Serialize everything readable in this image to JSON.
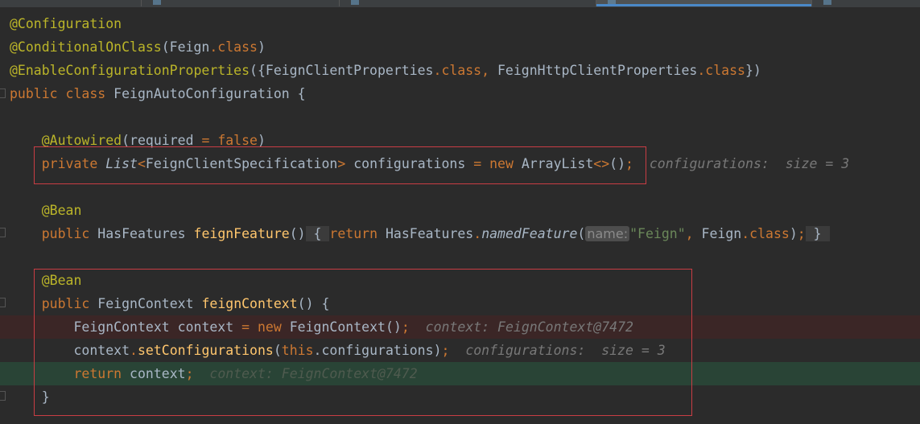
{
  "tabs": [
    {
      "label": "",
      "active": false
    },
    {
      "label": "",
      "active": false
    },
    {
      "label": "",
      "active": false
    },
    {
      "label": "",
      "active": true
    },
    {
      "label": "",
      "active": false
    }
  ],
  "colors": {
    "background": "#2b2b2b",
    "keyword": "#cc7832",
    "annotation": "#bbb529",
    "string": "#6a8759",
    "text": "#a9b7c6",
    "hint": "#787878",
    "highlight_red": "#3b2626",
    "highlight_green": "#294436",
    "box_red": "#c93d44"
  },
  "code": {
    "l1": {
      "ann": "@Configuration"
    },
    "l2": {
      "ann": "@ConditionalOnClass",
      "args": "(Feign",
      "dot": ".",
      "cls": "class",
      "close": ")"
    },
    "l3": {
      "ann": "@EnableConfigurationProperties",
      "open": "({FeignClientProperties",
      "dot1": ".",
      "cls1": "class",
      "comma": ", ",
      "second": "FeignHttpClientProperties",
      "dot2": ".",
      "cls2": "class",
      "close": "})"
    },
    "l4": {
      "kw1": "public",
      "kw2": "class",
      "name": "FeignAutoConfiguration",
      "brace": "{"
    },
    "l6": {
      "ann": "@Autowired",
      "open": "(required ",
      "eq": "=",
      "val": "false",
      "close": ")"
    },
    "l7": {
      "kw": "private",
      "type": "List",
      "lt": "<",
      "generic": "FeignClientSpecification",
      "gt": ">",
      "name": "configurations",
      "eq": "=",
      "new": "new",
      "ctor": "ArrayList",
      "diamond": "<>",
      "parens": "()",
      "semi": ";",
      "hint": "configurations:  size = 3"
    },
    "l9": {
      "ann": "@Bean"
    },
    "l10": {
      "kw": "public",
      "type": "HasFeatures",
      "name": "feignFeature",
      "parens": "()",
      "obrace": "{",
      "ret": "return",
      "cls": "HasFeatures",
      "dot": ".",
      "method": "namedFeature",
      "open": "(",
      "param_hint": "name:",
      "str": "\"Feign\"",
      "comma": ", ",
      "arg2": "Feign",
      "dot2": ".",
      "cls2": "class",
      "close": ")",
      "semi": ";",
      "cbrace": "}"
    },
    "l12": {
      "ann": "@Bean"
    },
    "l13": {
      "kw": "public",
      "type": "FeignContext",
      "name": "feignContext",
      "rest": "() {"
    },
    "l14": {
      "type": "FeignContext",
      "name": "context",
      "eq": "=",
      "new": "new",
      "ctor": "FeignContext",
      "parens": "()",
      "semi": ";",
      "hint": "context: FeignContext@7472"
    },
    "l15": {
      "obj": "context",
      "dot": ".",
      "method": "setConfigurations",
      "open": "(",
      "this": "this",
      "field": ".configurations",
      "close": ")",
      "semi": ";",
      "hint": "configurations:  size = 3"
    },
    "l16": {
      "ret": "return",
      "name": "context",
      "semi": ";",
      "hint": "context: FeignContext@7472"
    },
    "l17": {
      "brace": "}"
    }
  }
}
